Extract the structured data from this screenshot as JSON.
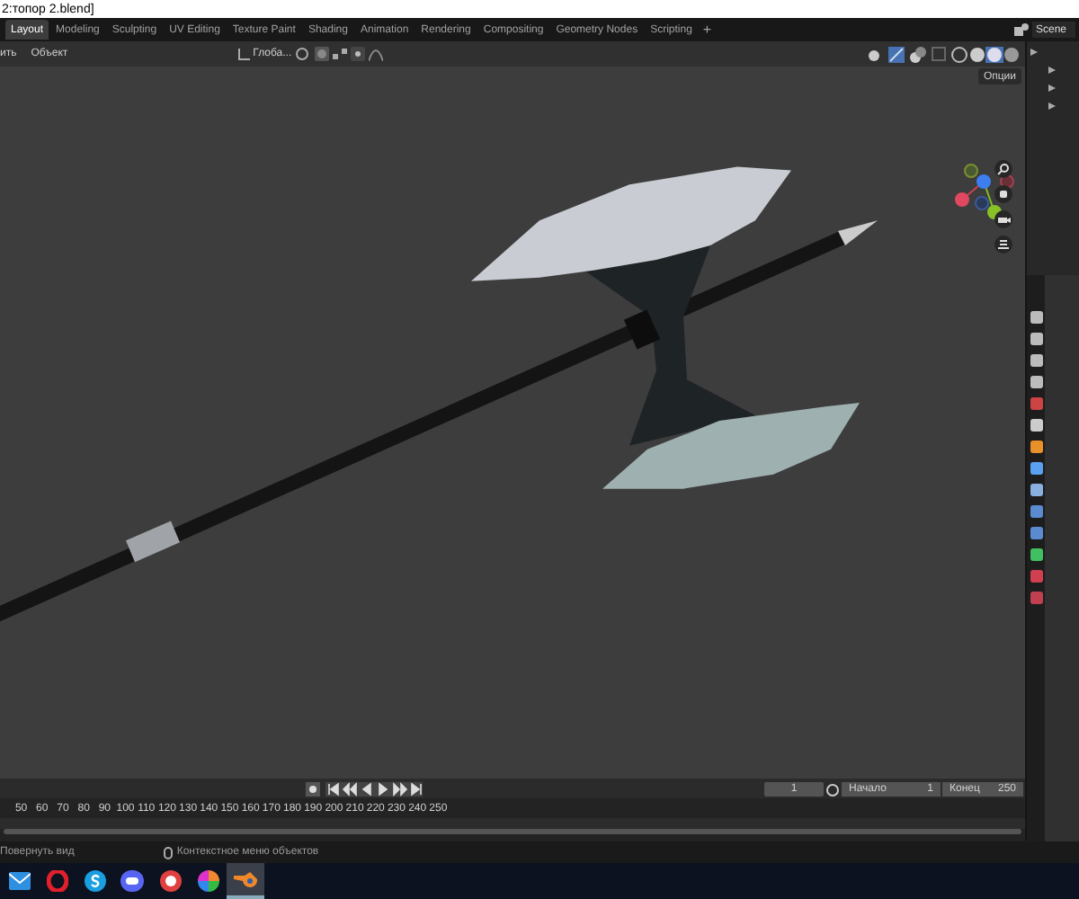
{
  "title_bar": {
    "title": "2:топор 2.blend]"
  },
  "workspace_tabs": [
    {
      "label": "Layout",
      "selected": true
    },
    {
      "label": "Modeling",
      "selected": false
    },
    {
      "label": "Sculpting",
      "selected": false
    },
    {
      "label": "UV Editing",
      "selected": false
    },
    {
      "label": "Texture Paint",
      "selected": false
    },
    {
      "label": "Shading",
      "selected": false
    },
    {
      "label": "Animation",
      "selected": false
    },
    {
      "label": "Rendering",
      "selected": false
    },
    {
      "label": "Compositing",
      "selected": false
    },
    {
      "label": "Geometry Nodes",
      "selected": false
    },
    {
      "label": "Scripting",
      "selected": false
    }
  ],
  "add_tab": "+",
  "scene": {
    "name": "Scene"
  },
  "header": {
    "menus": [
      "ить",
      "Объект"
    ],
    "orientation": "Глоба...",
    "options": "Опции"
  },
  "timeline": {
    "current_frame": "1",
    "start_label": "Начало",
    "start": "1",
    "end_label": "Конец",
    "end": "250",
    "ruler": [
      "50",
      "60",
      "70",
      "80",
      "90",
      "100",
      "110",
      "120",
      "130",
      "140",
      "150",
      "160",
      "170",
      "180",
      "190",
      "200",
      "210",
      "220",
      "230",
      "240",
      "250"
    ]
  },
  "status_bar": [
    "Повернуть вид",
    "Контекстное меню объектов"
  ],
  "taskbar": [
    {
      "kind": "mail",
      "selected": false
    },
    {
      "kind": "opera",
      "selected": false
    },
    {
      "kind": "skype",
      "selected": false
    },
    {
      "kind": "discord",
      "selected": false
    },
    {
      "kind": "tool",
      "selected": false
    },
    {
      "kind": "wheel",
      "selected": false
    },
    {
      "kind": "blender",
      "selected": true
    }
  ]
}
